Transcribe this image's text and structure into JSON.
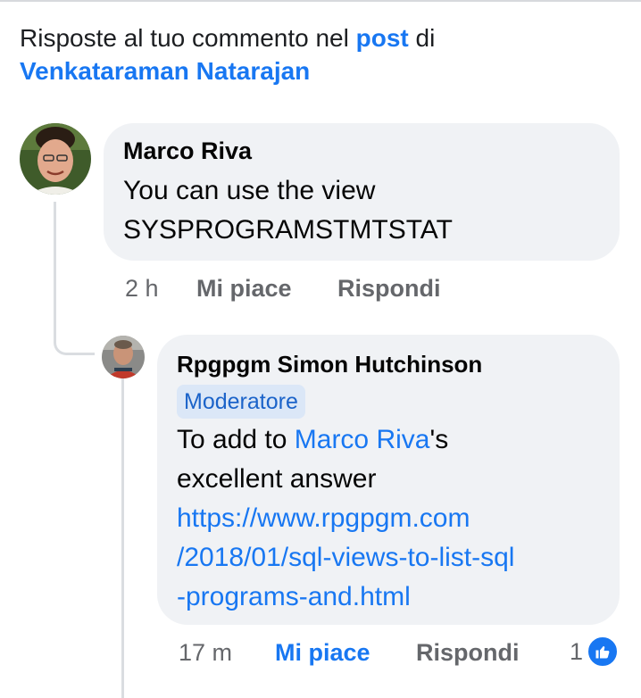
{
  "header": {
    "prefix": "Risposte al tuo commento nel ",
    "post_link": "post",
    "connector": " di",
    "author_link": "Venkataraman Natarajan"
  },
  "comment": {
    "author": "Marco Riva",
    "text_line1": "You can use the view",
    "text_line2": "SYSPROGRAMSTMTSTAT",
    "time": "2 h",
    "like_label": "Mi piace",
    "reply_label": "Rispondi"
  },
  "reply": {
    "author": "Rpgpgm Simon Hutchinson",
    "badge": "Moderatore",
    "text_prefix": "To add to ",
    "mention": "Marco Riva",
    "text_suffix": "'s",
    "text_line2": "excellent answer",
    "url_line1": "https://www.rpgpgm.com",
    "url_line2": "/2018/01/sql-views-to-list-sql",
    "url_line3": "-programs-and.html",
    "time": "17 m",
    "like_label": "Mi piace",
    "reply_label": "Rispondi",
    "reaction_count": "1",
    "reaction_icon": "thumbs-up-icon"
  },
  "colors": {
    "link": "#1877f2",
    "bubble": "#f0f2f5",
    "secondary_text": "#65676b",
    "badge_bg": "#dbe7f7"
  }
}
